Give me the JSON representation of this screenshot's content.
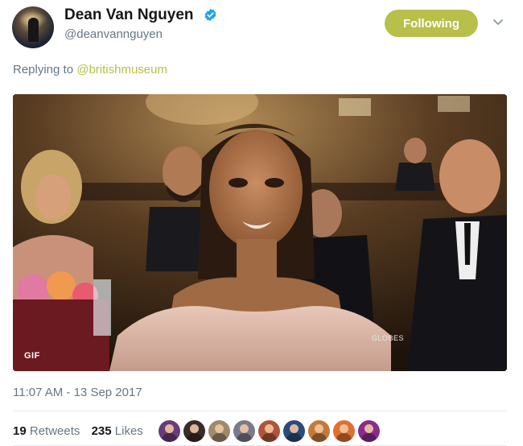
{
  "author": {
    "name": "Dean Van Nguyen",
    "handle": "@deanvannguyen",
    "verified": true
  },
  "follow_button": {
    "label": "Following"
  },
  "reply": {
    "prefix": "Replying to",
    "mention": "@britishmuseum"
  },
  "media": {
    "badge": "GIF",
    "watermark": "GLOBES",
    "icon": "animated-gif"
  },
  "timestamp": "11:07 AM - 13 Sep 2017",
  "stats": {
    "retweets_count": "19",
    "retweets_label": "Retweets",
    "likes_count": "235",
    "likes_label": "Likes"
  },
  "likers": [
    {
      "color": "#6a3b7a",
      "icon": "user-avatar"
    },
    {
      "color": "#3a2a2a",
      "icon": "user-avatar"
    },
    {
      "color": "#9c8a6a",
      "icon": "user-avatar"
    },
    {
      "color": "#7a7a8a",
      "icon": "user-avatar"
    },
    {
      "color": "#b0553a",
      "icon": "user-avatar"
    },
    {
      "color": "#2a4a7a",
      "icon": "user-avatar"
    },
    {
      "color": "#c27a3a",
      "icon": "user-avatar"
    },
    {
      "color": "#e07030",
      "icon": "user-avatar"
    },
    {
      "color": "#8a2a8a",
      "icon": "user-avatar"
    }
  ],
  "colors": {
    "accent": "#b6c04a",
    "text_secondary": "#657786",
    "verified_blue": "#1da1f2"
  }
}
